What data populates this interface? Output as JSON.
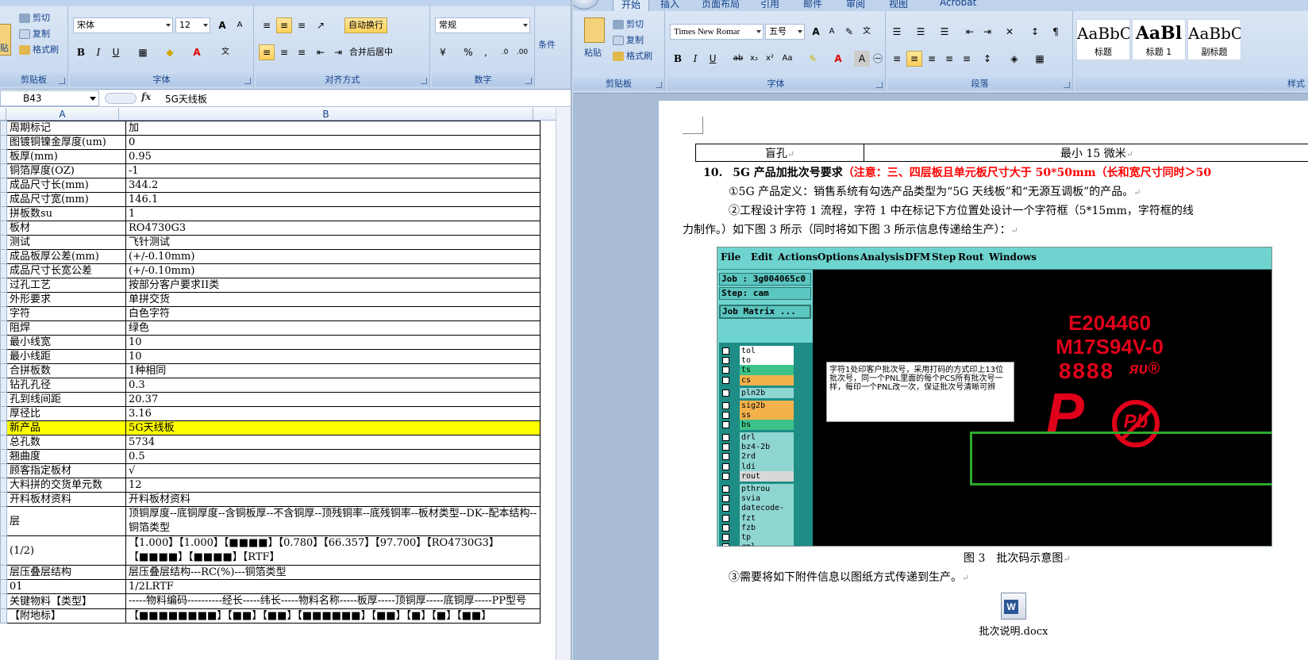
{
  "excel": {
    "ribbon": {
      "clipboard": {
        "paste": "贴",
        "cut": "剪切",
        "copy": "复制",
        "format_painter": "格式刷",
        "label": "剪贴板"
      },
      "font": {
        "name": "宋体",
        "size": "12",
        "label": "字体"
      },
      "alignment": {
        "wrap_text": "自动换行",
        "merge_center": "合并后居中",
        "label": "对齐方式"
      },
      "number": {
        "format": "常规",
        "percent": "%",
        "comma": ",",
        "inc_decimal": ".0",
        "dec_decimal": ".00",
        "label": "数字"
      },
      "styles": {
        "conditional": "条件"
      }
    },
    "formula_bar": {
      "cell_ref": "B43",
      "fx": "fx",
      "content": "5G天线板"
    },
    "columns": [
      "A",
      "B"
    ],
    "rows": [
      {
        "a": "周期标记",
        "b": "加"
      },
      {
        "a": "图镀铜镍金厚度(um)",
        "b": "0"
      },
      {
        "a": "板厚(mm)",
        "b": "0.95"
      },
      {
        "a": "铜箔厚度(OZ)",
        "b": "-1"
      },
      {
        "a": "成品尺寸长(mm)",
        "b": "344.2"
      },
      {
        "a": "成品尺寸宽(mm)",
        "b": "146.1"
      },
      {
        "a": "拼板数su",
        "b": "1"
      },
      {
        "a": "板材",
        "b": "RO4730G3"
      },
      {
        "a": "测试",
        "b": "飞针测试"
      },
      {
        "a": "成品板厚公差(mm)",
        "b": "(+/-0.10mm)"
      },
      {
        "a": "成品尺寸长宽公差",
        "b": "(+/-0.10mm)"
      },
      {
        "a": "过孔工艺",
        "b": "按部分客户要求II类"
      },
      {
        "a": "外形要求",
        "b": "单拼交货"
      },
      {
        "a": "字符",
        "b": "白色字符"
      },
      {
        "a": "阻焊",
        "b": "绿色"
      },
      {
        "a": "最小线宽",
        "b": "10"
      },
      {
        "a": "最小线距",
        "b": "10"
      },
      {
        "a": "合拼板数",
        "b": "1种相同"
      },
      {
        "a": "钻孔孔径",
        "b": "0.3"
      },
      {
        "a": "孔到线间距",
        "b": "20.37"
      },
      {
        "a": "厚径比",
        "b": "3.16"
      },
      {
        "a": "新产品",
        "b": "5G天线板"
      },
      {
        "a": "总孔数",
        "b": "5734"
      },
      {
        "a": "翘曲度",
        "b": "0.5"
      },
      {
        "a": "顾客指定板材",
        "b": "√"
      },
      {
        "a": "大料拼的交货单元数",
        "b": "12"
      },
      {
        "a": "开料板材资料",
        "b": "开料板材资料"
      },
      {
        "a": "层",
        "b": "顶铜厚度--底铜厚度--含铜板厚--不含铜厚--顶残铜率--底残铜率--板材类型--DK--配本结构--铜箔类型"
      },
      {
        "a": "(1/2)",
        "b": "【1.000】【1.000】【■■■■】【0.780】【66.357】【97.700】【RO4730G3】【■■■■】【■■■■】【RTF】"
      },
      {
        "a": "层压叠层结构",
        "b": "层压叠层结构---RC(%)---铜箔类型"
      },
      {
        "a": "01",
        "b": "1/2LRTF"
      },
      {
        "a": "关键物料【类型】",
        "b": "-----物料编码----------经长-----纬长-----物料名称-----板厚-----顶铜厚-----底铜厚-----PP型号"
      },
      {
        "a": "【附地标】",
        "b": "【■■■■■■■■】【■■】【■■】【■■■■■■】【■■】【■】【■】【■■】"
      }
    ]
  },
  "word": {
    "tabs": [
      "开始",
      "插入",
      "页面布局",
      "引用",
      "邮件",
      "审阅",
      "视图",
      "Acrobat"
    ],
    "ribbon": {
      "clipboard": {
        "paste": "粘贴",
        "cut": "剪切",
        "copy": "复制",
        "format_painter": "格式刷",
        "label": "剪贴板"
      },
      "font": {
        "name": "Times New Romar",
        "size": "五号",
        "label": "字体"
      },
      "paragraph": {
        "label": "段落"
      },
      "styles": {
        "label": "样式",
        "items": [
          {
            "preview": "AaBbC",
            "name": "标题"
          },
          {
            "preview": "AaBl",
            "name": "标题 1"
          },
          {
            "preview": "AaBbC",
            "name": "副标题"
          }
        ]
      }
    },
    "doc": {
      "table_row": {
        "left": "盲孔",
        "right": "最小 15 微米"
      },
      "heading_num": "10.",
      "heading_text": "5G 产品加批次号要求",
      "heading_red": "（注意：三、四层板且单元板尺寸大于 50*50mm（长和宽尺寸同时＞50",
      "p1": "①5G 产品定义：销售系统有勾选产品类型为“5G 天线板”和“无源互调板”的产品。",
      "p2": "②工程设计字符 1 流程，字符 1 中在标记下方位置处设计一个字符框（5*15mm，字符框的线",
      "p3": "力制作。）如下图 3 所示（同时将如下图 3 所示信息传递给生产）：",
      "figure_caption": "图 3　批次码示意图",
      "p4": "③需要将如下附件信息以图纸方式传递到生产。",
      "attachment": "批次说明.docx"
    },
    "cam": {
      "menu": [
        "File",
        "Edit",
        "Actions",
        "Options",
        "Analysis",
        "DFM",
        "Step",
        "Rout",
        "Windows"
      ],
      "job": "Job : 3g004065c0",
      "step": "Step: cam",
      "matrix": "Job Matrix ...",
      "layers": [
        "tol",
        "to",
        "ts",
        "cs",
        "pln2b",
        "sig2b",
        "ss",
        "bs",
        "drl",
        "bz4-2b",
        "2rd",
        "ldi",
        "rout",
        "pthrou",
        "svia",
        "datecode-to",
        "fzt",
        "fzb",
        "tp",
        "gml"
      ],
      "note": "字符1处印客户批次号，采用打码的方式印上13位批次号，同一个PNL里面的每个PCS所有批次号一样，每印一个PNL改一次，保证批次号清晰可辨",
      "ul_line1": "E204460",
      "ul_line2": "M17S94V-0",
      "ul_line3": "8888",
      "ul_mark": "ᴙᴜ®",
      "logo_letter": "P",
      "pb_text": "Pb",
      "colors": {
        "bg": "#000000",
        "red": "#e0001a",
        "green": "#2eaa2e",
        "panel": "#6fd4cf"
      }
    }
  }
}
